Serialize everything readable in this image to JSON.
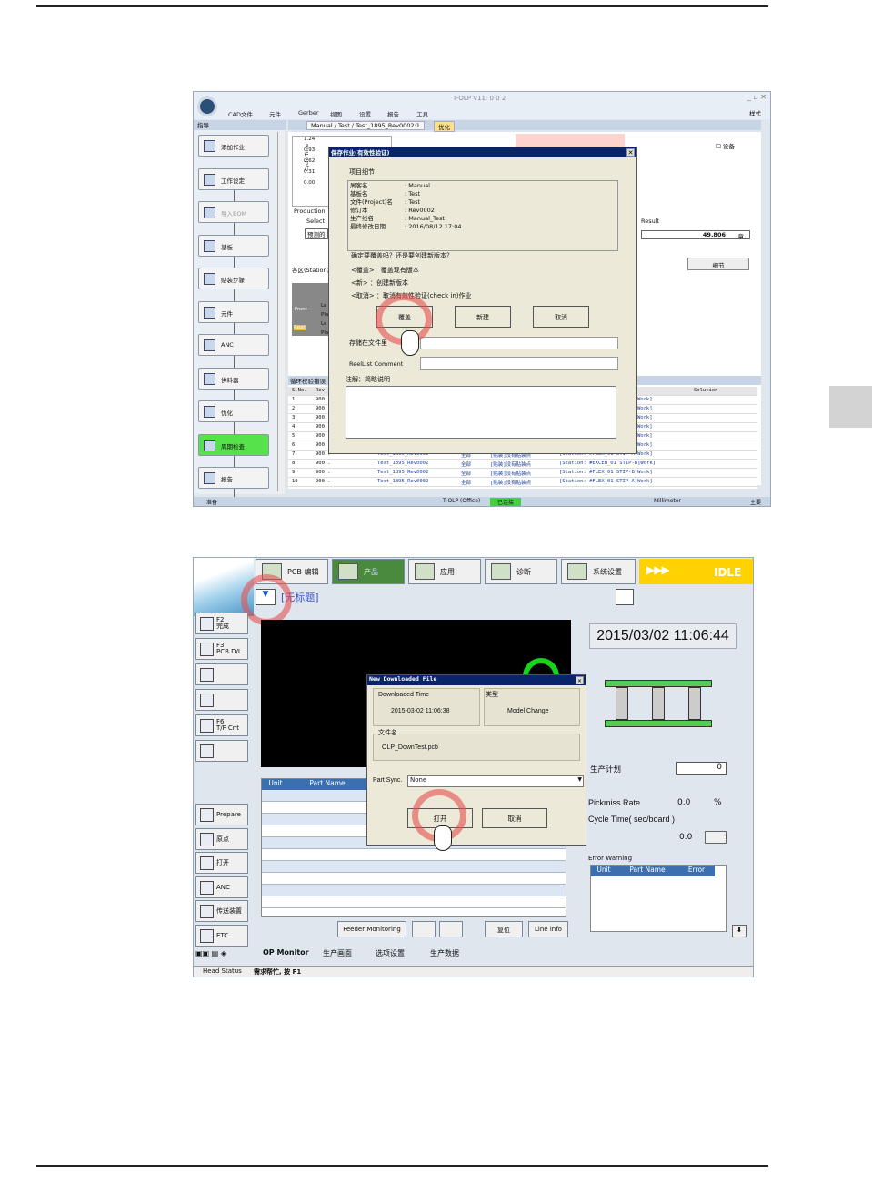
{
  "screen1": {
    "app_title": "T-OLP V11: 0 0 2",
    "menu": [
      "CAD文件",
      "元件",
      "Gerber",
      "视图",
      "设置",
      "报告",
      "工具"
    ],
    "style_menu": "样式",
    "nav_header": "指导",
    "doc_tab": "Manual / Test / Test_1895_Rev0002:1",
    "active_tab": "优化",
    "nav_buttons": [
      "添加作业",
      "工作设定",
      "导入BOM",
      "基板",
      "贴装步骤",
      "元件",
      "ANC",
      "供料器",
      "优化",
      "周期检查",
      "报告"
    ],
    "cycle_axis_label": "Cycle Time",
    "cycle_ticks": [
      "1.24",
      "0.93",
      "0.62",
      "0.31",
      "0.00"
    ],
    "equipment_check": "设备",
    "production_label": "Production",
    "select_label": "Select",
    "predict_value": "预测的",
    "result_label": "Result",
    "result_value": "49.806",
    "result_unit": "章",
    "detail_button": "细节",
    "zone_label": "各区(Station)",
    "front_label": "Front",
    "rear_label": "Rear",
    "lane_labels": [
      "Le",
      "Pla",
      "Le",
      "Pla"
    ],
    "error_panel_title": "循环校验错误",
    "grid_headers": [
      "S.No.",
      "Rev.",
      "Solution"
    ],
    "grid_rows": [
      {
        "n": "1",
        "rev": "900.."
      },
      {
        "n": "2",
        "rev": "900.."
      },
      {
        "n": "3",
        "rev": "900.."
      },
      {
        "n": "4",
        "rev": "900.."
      },
      {
        "n": "5",
        "rev": "900.."
      },
      {
        "n": "6",
        "rev": "900.."
      },
      {
        "n": "7",
        "rev": "900..",
        "job": "Test_1895_Rev0002",
        "all": "全部",
        "msg": "[贴装]没有贴装点",
        "st": "[Station: #FLEX_01 STIP-A]Work]"
      },
      {
        "n": "8",
        "rev": "900..",
        "job": "Test_1895_Rev0002",
        "all": "全部",
        "msg": "[贴装]没有贴装点",
        "st": "[Station: #EXCEN_01 STIP-B]Work]"
      },
      {
        "n": "9",
        "rev": "900..",
        "job": "Test_1895_Rev0002",
        "all": "全部",
        "msg": "[贴装]没有贴装点",
        "st": "[Station: #FLEX_01 STIP-B]Work]"
      },
      {
        "n": "10",
        "rev": "900..",
        "job": "Test_1895_Rev0002",
        "all": "全部",
        "msg": "[贴装]没有贴装点",
        "st": "[Station: #FLEX_01 STIP-A]Work]"
      }
    ],
    "work_suffixes": [
      "Work]",
      "Work]",
      "Work]",
      "Work]",
      "Work]",
      "Work]"
    ],
    "status": {
      "ready": "准备",
      "env": "T-OLP (Office)",
      "conn": "已连接",
      "unit": "Millimeter",
      "main": "主要"
    },
    "dialog": {
      "title": "保存作业(有效性验证)",
      "section": "项目细节",
      "info_labels": [
        "屑客名",
        "基板名",
        "文件(Project)名",
        "修订本",
        "生产线名",
        "最终修改日期"
      ],
      "info_values": [
        ": Manual",
        ": Test",
        ": Test",
        ": Rev0002",
        ": Manual_Test",
        ": 2016/08/12 17:04"
      ],
      "question": "确定要覆盖吗？还是要创建新版本？",
      "opt_overwrite": "<覆盖>：覆盖现有版本",
      "opt_new": "<新>    ：创建新版本",
      "opt_cancel": "<取消>  ：取消有效性验证(check in)作业",
      "btn_overwrite": "覆盖",
      "btn_new": "新建",
      "btn_cancel": "取消",
      "save_file_label": "存储在文件里",
      "reellist_label": "ReelList Comment",
      "note_label": "注解：简略说明"
    }
  },
  "screen2": {
    "toolbar": [
      "PCB 编辑",
      "产品",
      "应用",
      "诊断",
      "系统设置"
    ],
    "status_idle": "IDLE",
    "file_title": "[无标题]",
    "left_buttons_top": [
      {
        "key": "F2",
        "label": "完成"
      },
      {
        "key": "F3",
        "label": "PCB D/L"
      },
      {
        "key": "",
        "label": ""
      },
      {
        "key": "",
        "label": ""
      },
      {
        "key": "F6",
        "label": "T/F Cnt"
      },
      {
        "key": "",
        "label": ""
      }
    ],
    "left_buttons_bottom": [
      "Prepare",
      "原点",
      "打开",
      "ANC",
      "传送装置",
      "ETC"
    ],
    "datetime": "2015/03/02   11:06:44",
    "parts_headers": [
      "Unit",
      "Part Name"
    ],
    "production_plan_label": "生产计划",
    "production_plan_value": "0",
    "pickmiss_label": "Pickmiss Rate",
    "pickmiss_value": "0.0",
    "pickmiss_unit": "%",
    "cycle_label": "Cycle Time( sec/board )",
    "cycle_value": "0.0",
    "error_warning_label": "Error Warning",
    "error_headers": [
      "Unit",
      "Part Name",
      "Error"
    ],
    "bottom_buttons": [
      "Feeder Monitoring",
      "复位",
      "Line info"
    ],
    "bottom_tabs": [
      "OP Monitor",
      "生产画面",
      "选项设置",
      "生产数据"
    ],
    "head_status": "Head Status",
    "help_text": "需求帮忙, 按 F1",
    "dialog": {
      "title": "New Downloaded File",
      "downloaded_time_label": "Downloaded Time",
      "downloaded_time": "2015-03-02 11:06:38",
      "type_label": "类型",
      "type_value": "Model Change",
      "file_label": "文件名",
      "file_value": "OLP_DownTest.pcb",
      "part_sync_label": "Part Sync.",
      "part_sync_value": "None",
      "btn_open": "打开",
      "btn_cancel": "取消"
    }
  }
}
